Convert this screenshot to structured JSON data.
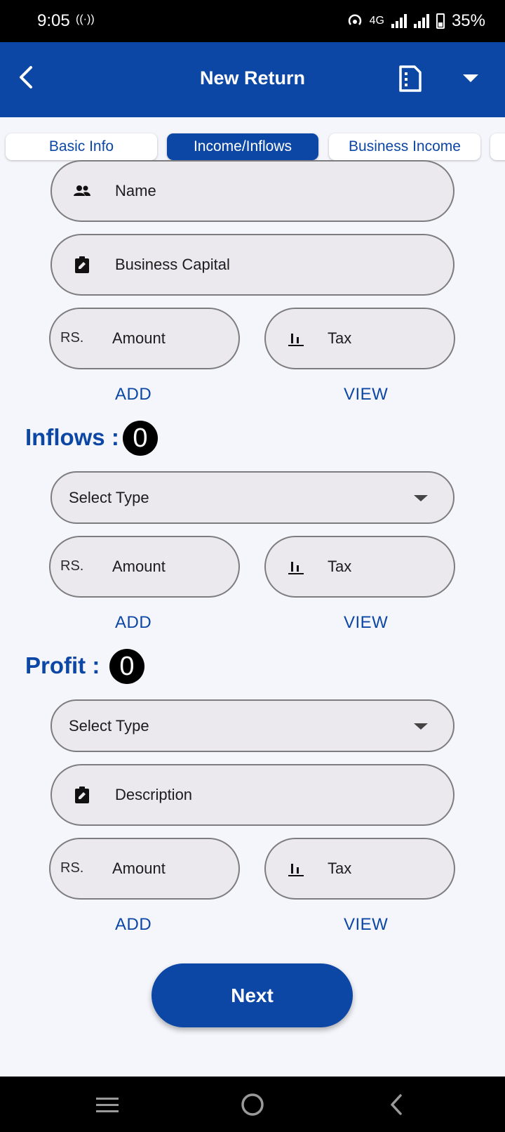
{
  "status_bar": {
    "time": "9:05",
    "network": "4G",
    "battery": "35%"
  },
  "app_bar": {
    "title": "New Return"
  },
  "tabs": [
    {
      "label": "Basic Info"
    },
    {
      "label": "Income/Inflows",
      "active": true
    },
    {
      "label": "Business Income"
    }
  ],
  "business": {
    "name_placeholder": "Name",
    "capital_placeholder": "Business Capital",
    "currency": "RS.",
    "amount_placeholder": "Amount",
    "tax_placeholder": "Tax",
    "add_label": "ADD",
    "view_label": "VIEW"
  },
  "inflows": {
    "heading": "Inflows :",
    "count": "0",
    "select_placeholder": "Select Type",
    "currency": "RS.",
    "amount_placeholder": "Amount",
    "tax_placeholder": "Tax",
    "add_label": "ADD",
    "view_label": "VIEW"
  },
  "profit": {
    "heading": "Profit :",
    "count": "0",
    "select_placeholder": "Select Type",
    "description_placeholder": "Description",
    "currency": "RS.",
    "amount_placeholder": "Amount",
    "tax_placeholder": "Tax",
    "add_label": "ADD",
    "view_label": "VIEW"
  },
  "next_label": "Next",
  "colors": {
    "primary": "#0c47a5",
    "field_bg": "#ebe9ee",
    "page_bg": "#f5f6fb"
  }
}
